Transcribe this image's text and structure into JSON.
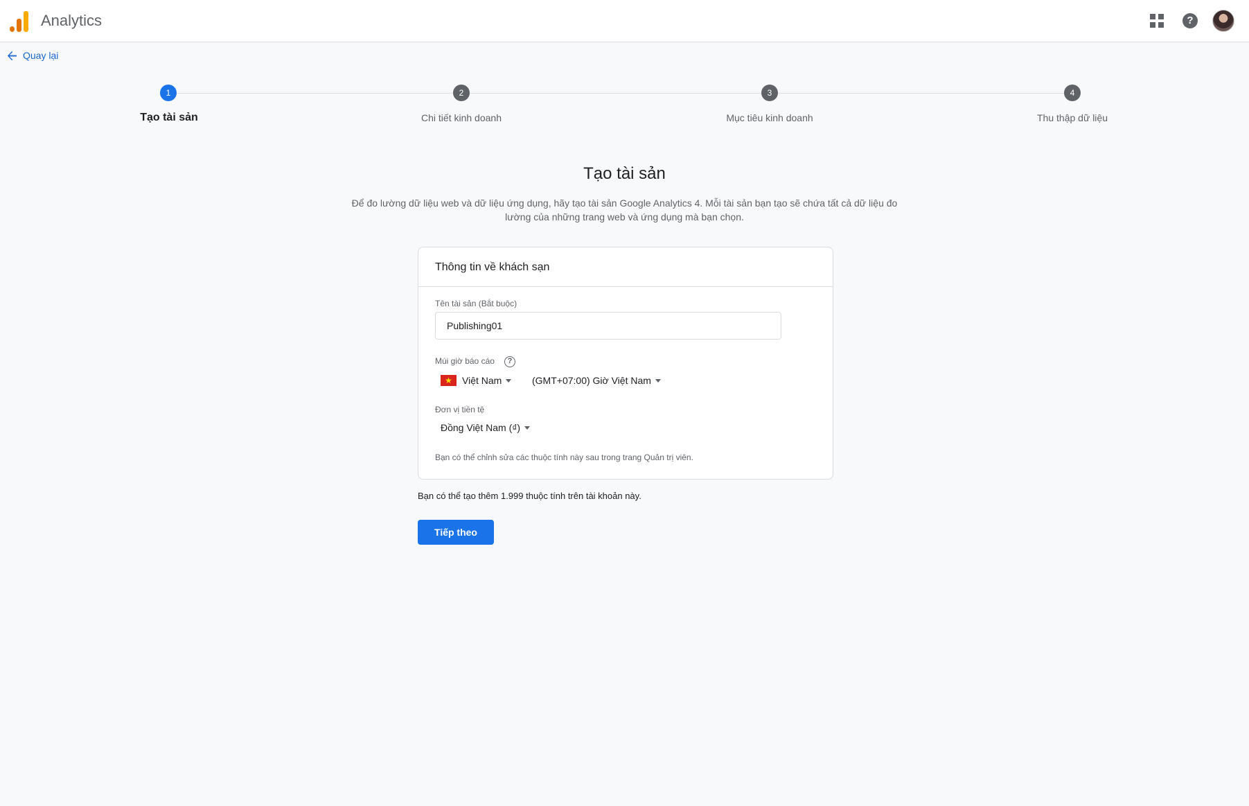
{
  "app": {
    "title": "Analytics",
    "logo_icon": "analytics-logo",
    "header_icons": [
      "apps-grid-icon",
      "help-icon",
      "account-avatar"
    ]
  },
  "back": {
    "label": "Quay lại",
    "icon": "arrow-left-icon"
  },
  "stepper": {
    "steps": [
      {
        "number": "1",
        "label": "Tạo tài sản",
        "active": true
      },
      {
        "number": "2",
        "label": "Chi tiết kinh doanh",
        "active": false
      },
      {
        "number": "3",
        "label": "Mục tiêu kinh doanh",
        "active": false
      },
      {
        "number": "4",
        "label": "Thu thập dữ liệu",
        "active": false
      }
    ]
  },
  "page": {
    "title": "Tạo tài sản",
    "description": "Để đo lường dữ liệu web và dữ liệu ứng dụng, hãy tạo tài sản Google Analytics 4. Mỗi tài sản bạn tạo sẽ chứa tất cả dữ liệu đo lường của những trang web và ứng dụng mà bạn chọn."
  },
  "card": {
    "header": "Thông tin về khách sạn",
    "property_name": {
      "label": "Tên tài sản (Bắt buộc)",
      "value": "Publishing01"
    },
    "timezone": {
      "label": "Múi giờ báo cáo",
      "help_icon": "help-circle-icon",
      "country": "Việt Nam",
      "country_flag": "vietnam-flag-icon",
      "zone": "(GMT+07:00) Giờ Việt Nam"
    },
    "currency": {
      "label": "Đơn vị tiền tệ",
      "value": "Đồng Việt Nam (₫)"
    },
    "hint": "Bạn có thể chỉnh sửa các thuộc tính này sau trong trang Quản trị viên."
  },
  "remaining_note": "Bạn có thể tạo thêm 1.999 thuộc tính trên tài khoản này.",
  "next_button": "Tiếp theo",
  "colors": {
    "primary": "#1a73e8",
    "link": "#1967d2",
    "inactive_step": "#5f6368",
    "background": "#f8f9fa"
  }
}
